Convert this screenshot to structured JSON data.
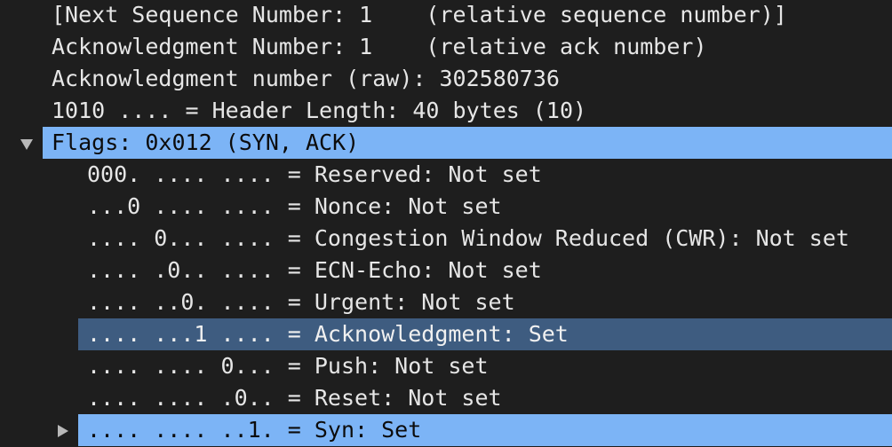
{
  "tree": {
    "rows": [
      {
        "text": "[Next Sequence Number: 1    (relative sequence number)]",
        "level": 1
      },
      {
        "text": "Acknowledgment Number: 1    (relative ack number)",
        "level": 1
      },
      {
        "text": "Acknowledgment number (raw): 302580736",
        "level": 1
      },
      {
        "text": "1010 .... = Header Length: 40 bytes (10)",
        "level": 1
      },
      {
        "text": "Flags: 0x012 (SYN, ACK)",
        "level": 1,
        "expander": "expanded",
        "icon": "triangle-down-icon",
        "selected": "primary"
      },
      {
        "text": "000. .... .... = Reserved: Not set",
        "level": 2
      },
      {
        "text": "...0 .... .... = Nonce: Not set",
        "level": 2
      },
      {
        "text": ".... 0... .... = Congestion Window Reduced (CWR): Not set",
        "level": 2
      },
      {
        "text": ".... .0.. .... = ECN-Echo: Not set",
        "level": 2
      },
      {
        "text": ".... ..0. .... = Urgent: Not set",
        "level": 2
      },
      {
        "text": ".... ...1 .... = Acknowledgment: Set",
        "level": 2,
        "selected": "related"
      },
      {
        "text": ".... .... 0... = Push: Not set",
        "level": 2
      },
      {
        "text": ".... .... .0.. = Reset: Not set",
        "level": 2
      },
      {
        "text": ".... .... ..1. = Syn: Set",
        "level": 2,
        "expander": "collapsed",
        "icon": "triangle-right-icon",
        "selected": "primary"
      }
    ]
  },
  "colors": {
    "background": "#1e1e1e",
    "text": "#e6e6e6",
    "selection_primary": "#7cb4f6",
    "selection_related": "#3e5c80"
  }
}
